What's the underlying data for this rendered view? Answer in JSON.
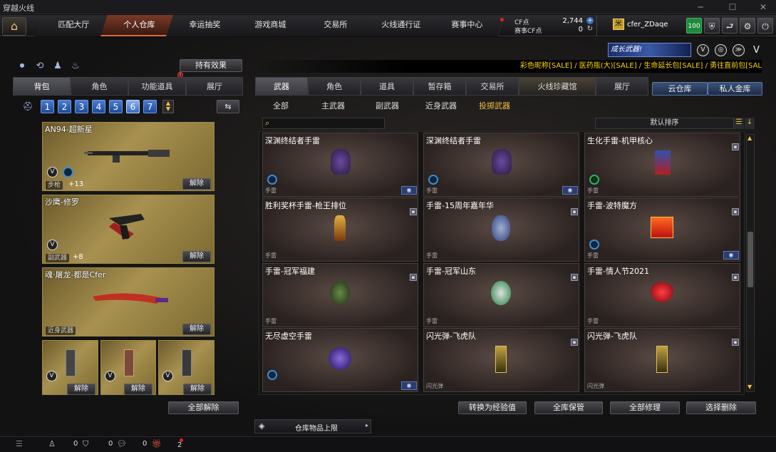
{
  "window": {
    "title": "穿越火线"
  },
  "nav": {
    "tabs": [
      "匹配大厅",
      "个人仓库",
      "幸运抽奖",
      "游戏商城",
      "交易所",
      "火线通行证",
      "赛事中心"
    ],
    "cf_label": "CF点",
    "cf_value": "2,744",
    "match_cf_label": "赛事CF点",
    "match_cf_value": "0",
    "username": "cfer_ZDaqe",
    "level": "100"
  },
  "banner": {
    "text": "成长武器!"
  },
  "ticker": "彩色昵称[SALE] / 医药瓶(大)[SALE] / 生命延长包[SALE] / 勇往直前包[SAL",
  "left": {
    "held_effect": "持有效果",
    "tabs": [
      "背包",
      "角色",
      "功能道具",
      "展厅"
    ],
    "pages": [
      "1",
      "2",
      "3",
      "4",
      "5",
      "6",
      "7"
    ],
    "cards": [
      {
        "name": "AN94-超新星",
        "tag": "步枪",
        "plus": "+13",
        "btn": "解除"
      },
      {
        "name": "沙鹰-修罗",
        "tag": "副武器",
        "plus": "+8",
        "btn": "解除"
      },
      {
        "name": "魂·屠龙-都是Cfer",
        "tag": "近身武器",
        "btn": "解除"
      }
    ],
    "small_btns": [
      "解除",
      "解除",
      "解除"
    ],
    "release_all": "全部解除"
  },
  "right": {
    "tabs": [
      "武器",
      "角色",
      "道具",
      "暂存箱",
      "交易所",
      "火线珍藏馆",
      "展厅"
    ],
    "cloud": "云仓库",
    "private": "私人金库",
    "subtabs": [
      "全部",
      "主武器",
      "副武器",
      "近身武器",
      "投掷武器"
    ],
    "sort": "默认排序",
    "items": [
      {
        "name": "深渊终结者手雷",
        "cat": "手雷"
      },
      {
        "name": "深渊终结者手雷",
        "cat": "手雷"
      },
      {
        "name": "生化手雷-机甲核心",
        "cat": "手雷"
      },
      {
        "name": "胜利奖杯手雷-枪王排位",
        "cat": "手雷"
      },
      {
        "name": "手雷-15周年嘉年华",
        "cat": "手雷"
      },
      {
        "name": "手雷-波特魔方",
        "cat": "手雷"
      },
      {
        "name": "手雷-冠军福建",
        "cat": "手雷"
      },
      {
        "name": "手雷-冠军山东",
        "cat": "手雷"
      },
      {
        "name": "手雷-情人节2021",
        "cat": "手雷"
      },
      {
        "name": "无尽虚空手雷",
        "cat": ""
      },
      {
        "name": "闪光弹-飞虎队",
        "cat": "闪光弹"
      },
      {
        "name": "闪光弹-飞虎队",
        "cat": "闪光弹"
      }
    ],
    "bottom_btns": [
      "转换为经验值",
      "全库保管",
      "全部修理",
      "选择删除"
    ],
    "storage": "仓库物品上限"
  },
  "status": {
    "v1": "0",
    "v2": "0",
    "v3": "0",
    "v4": "2"
  }
}
